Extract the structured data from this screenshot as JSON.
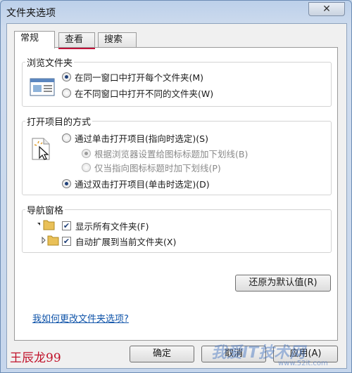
{
  "window": {
    "title": "文件夹选项",
    "close": "✕"
  },
  "tabs": [
    {
      "label": "常规",
      "active": true
    },
    {
      "label": "查看",
      "active": false
    },
    {
      "label": "搜索",
      "active": false
    }
  ],
  "browse": {
    "title": "浏览文件夹",
    "option1": "在同一窗口中打开每个文件夹(M)",
    "option2": "在不同窗口中打开不同的文件夹(W)"
  },
  "open_items": {
    "title": "打开项目的方式",
    "option1": "通过单击打开项目(指向时选定)(S)",
    "sub1": "根据浏览器设置给图标标题加下划线(B)",
    "sub2": "仅当指向图标标题时加下划线(P)",
    "option2": "通过双击打开项目(单击时选定)(D)"
  },
  "nav_pane": {
    "title": "导航窗格",
    "check1": "显示所有文件夹(F)",
    "check2": "自动扩展到当前文件夹(X)"
  },
  "buttons": {
    "restore": "还原为默认值(R)",
    "ok": "确定",
    "cancel": "取消",
    "apply": "应用(A)"
  },
  "help_link": "我如何更改文件夹选项?",
  "watermarks": {
    "author": "王辰龙99",
    "site_logo": "我爱IT技术网",
    "site_url": "www.52it.com"
  },
  "colors": {
    "accent": "#1e3f78",
    "link": "#1155aa",
    "watermark": "#c0122a"
  }
}
